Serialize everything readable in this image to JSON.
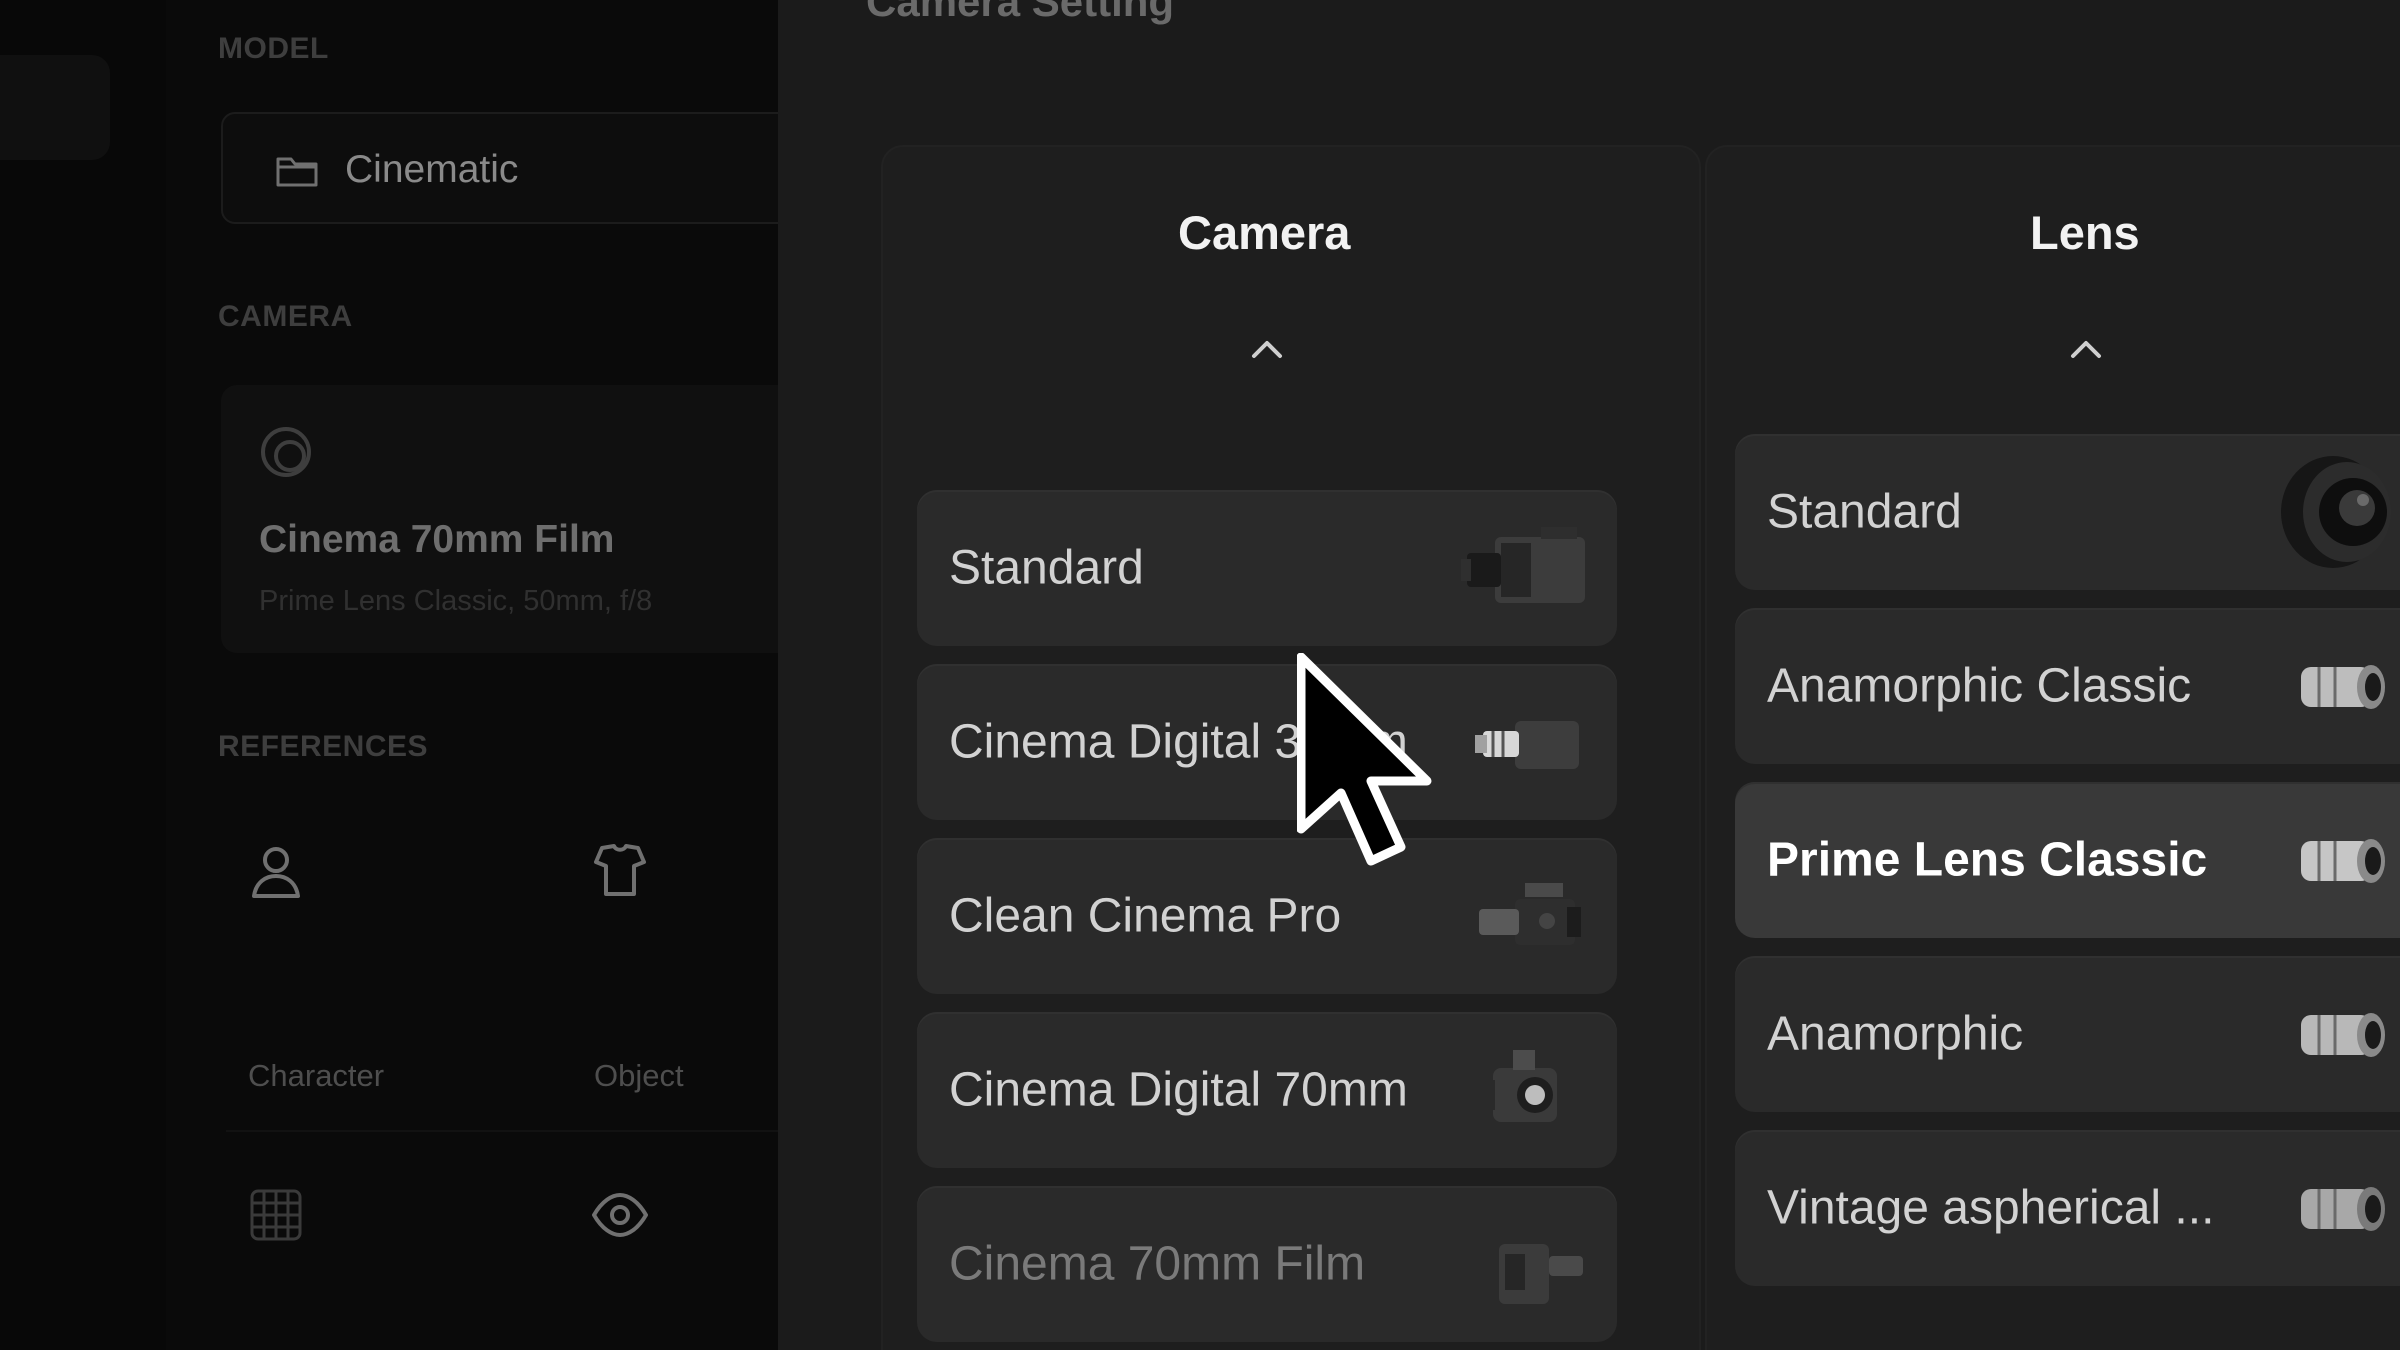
{
  "sidebar": {
    "model_label": "MODEL",
    "model_value": "Cinematic",
    "camera_label": "CAMERA",
    "camera_name": "Cinema 70mm Film",
    "camera_details": "Prime Lens Classic, 50mm, f/8",
    "references_label": "REFERENCES",
    "references": [
      {
        "label": "Character",
        "icon": "person-icon"
      },
      {
        "label": "Object",
        "icon": "shirt-icon"
      },
      {
        "label": "",
        "icon": "texture-grid-icon"
      },
      {
        "label": "",
        "icon": "eye-icon"
      }
    ]
  },
  "panel": {
    "title": "Camera Setting",
    "columns": {
      "camera": {
        "title": "Camera",
        "items": [
          {
            "label": "Standard",
            "icon": "cinema-camera-icon"
          },
          {
            "label": "Cinema Digital 35mm",
            "icon": "compact-camera-icon"
          },
          {
            "label": "Clean Cinema Pro",
            "icon": "pro-camera-icon"
          },
          {
            "label": "Cinema Digital 70mm",
            "icon": "digital-camera-icon"
          },
          {
            "label": "Cinema 70mm Film",
            "icon": "film-camera-icon"
          }
        ]
      },
      "lens": {
        "title": "Lens",
        "items": [
          {
            "label": "Standard",
            "icon": "lens-icon"
          },
          {
            "label": "Anamorphic Classic",
            "icon": "lens-icon"
          },
          {
            "label": "Prime Lens Classic",
            "icon": "lens-icon",
            "selected": true
          },
          {
            "label": "Anamorphic",
            "icon": "lens-icon"
          },
          {
            "label": "Vintage aspherical ...",
            "icon": "lens-icon"
          }
        ]
      }
    }
  },
  "colors": {
    "panel_bg": "#1b1b1b",
    "item_bg": "#2a2a2a",
    "item_selected_bg": "#393939",
    "text_primary": "#ffffff"
  }
}
